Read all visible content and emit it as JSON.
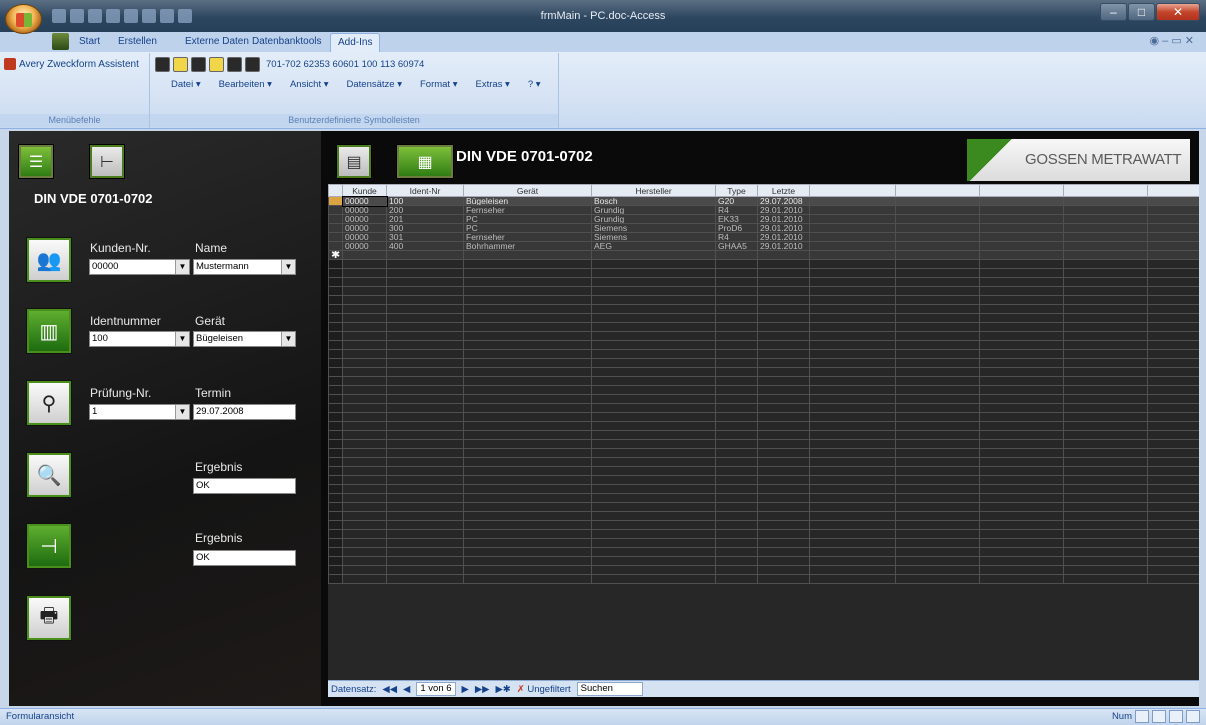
{
  "window": {
    "title": "frmMain - PC.doc-Access"
  },
  "ribbon_tabs": [
    "Start",
    "Erstellen",
    "Externe Daten",
    "Datenbanktools",
    "Add-Ins"
  ],
  "ribbon": {
    "avery": "Avery Zweckform Assistent",
    "toolbar_text": "701-702  62353  60601  100  113  60974",
    "menus": [
      "Datei ▾",
      "Bearbeiten ▾",
      "Ansicht ▾",
      "Datensätze ▾",
      "Format ▾",
      "Extras ▾",
      "? ▾"
    ],
    "group1": "Menübefehle",
    "group2": "Benutzerdefinierte Symbolleisten"
  },
  "panel": {
    "title": "DIN VDE 0701-0702",
    "kunden_label": "Kunden-Nr.",
    "kunden_value": "00000",
    "name_label": "Name",
    "name_value": "Mustermann",
    "ident_label": "Identnummer",
    "ident_value": "100",
    "geraet_label": "Gerät",
    "geraet_value": "Bügeleisen",
    "pruef_label": "Prüfung-Nr.",
    "pruef_value": "1",
    "termin_label": "Termin",
    "termin_value": "29.07.2008",
    "ergebnis1_label": "Ergebnis",
    "ergebnis1_value": "OK",
    "ergebnis2_label": "Ergebnis",
    "ergebnis2_value": "OK"
  },
  "grid": {
    "title": "DIN VDE 0701-0702",
    "logo": "GOSSEN METRAWATT",
    "columns": [
      "Kunde",
      "Ident-Nr",
      "Gerät",
      "Hersteller",
      "Type",
      "Letzte"
    ],
    "rows": [
      [
        "00000",
        "100",
        "Bügeleisen",
        "Bosch",
        "G20",
        "29.07.2008"
      ],
      [
        "00000",
        "200",
        "Fernseher",
        "Grundig",
        "R4",
        "29.01.2010"
      ],
      [
        "00000",
        "201",
        "PC",
        "Grundig",
        "EK33",
        "29.01.2010"
      ],
      [
        "00000",
        "300",
        "PC",
        "Siemens",
        "ProD6",
        "29.01.2010"
      ],
      [
        "00000",
        "301",
        "Fernseher",
        "Siemens",
        "R4",
        "29.01.2010"
      ],
      [
        "00000",
        "400",
        "Bohrhammer",
        "AEG",
        "GHAA5",
        "29.01.2010"
      ]
    ],
    "new_row_marker": "✱"
  },
  "nav": {
    "label": "Datensatz:",
    "first": "◀◀",
    "prev": "◀",
    "position": "1 von 6",
    "next": "▶",
    "last": "▶▶",
    "new": "▶✱",
    "filter": "Ungefiltert",
    "search": "Suchen"
  },
  "status": {
    "left": "Formularansicht",
    "num": "Num"
  }
}
